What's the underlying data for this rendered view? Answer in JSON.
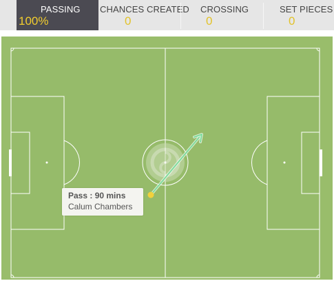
{
  "tabs": [
    {
      "label": "PASSING",
      "value": "100%",
      "active": true
    },
    {
      "label": "CHANCES CREATED",
      "value": "0",
      "active": false
    },
    {
      "label": "CROSSING",
      "value": "0",
      "active": false
    },
    {
      "label": "SET PIECES",
      "value": "0",
      "active": false
    }
  ],
  "pitch": {
    "icons": [
      "football-pitch",
      "club-crest-watermark"
    ],
    "colors": {
      "grass": "#96bb6a",
      "grass_outer": "#99bd6b",
      "lines": "#ffffff",
      "pass_line": "#7fdc9c",
      "pass_origin": "#f2d13c"
    },
    "pass": {
      "type": "Pass",
      "minute": "90 mins",
      "player": "Calum Chambers",
      "outcome": "successful"
    }
  },
  "tooltip": {
    "title": "Pass : 90 mins",
    "player": "Calum Chambers"
  },
  "colors": {
    "tab_active_bg": "#4b4a52",
    "tab_bg": "#e6e6e6",
    "value_yellow": "#f2cd2e"
  }
}
